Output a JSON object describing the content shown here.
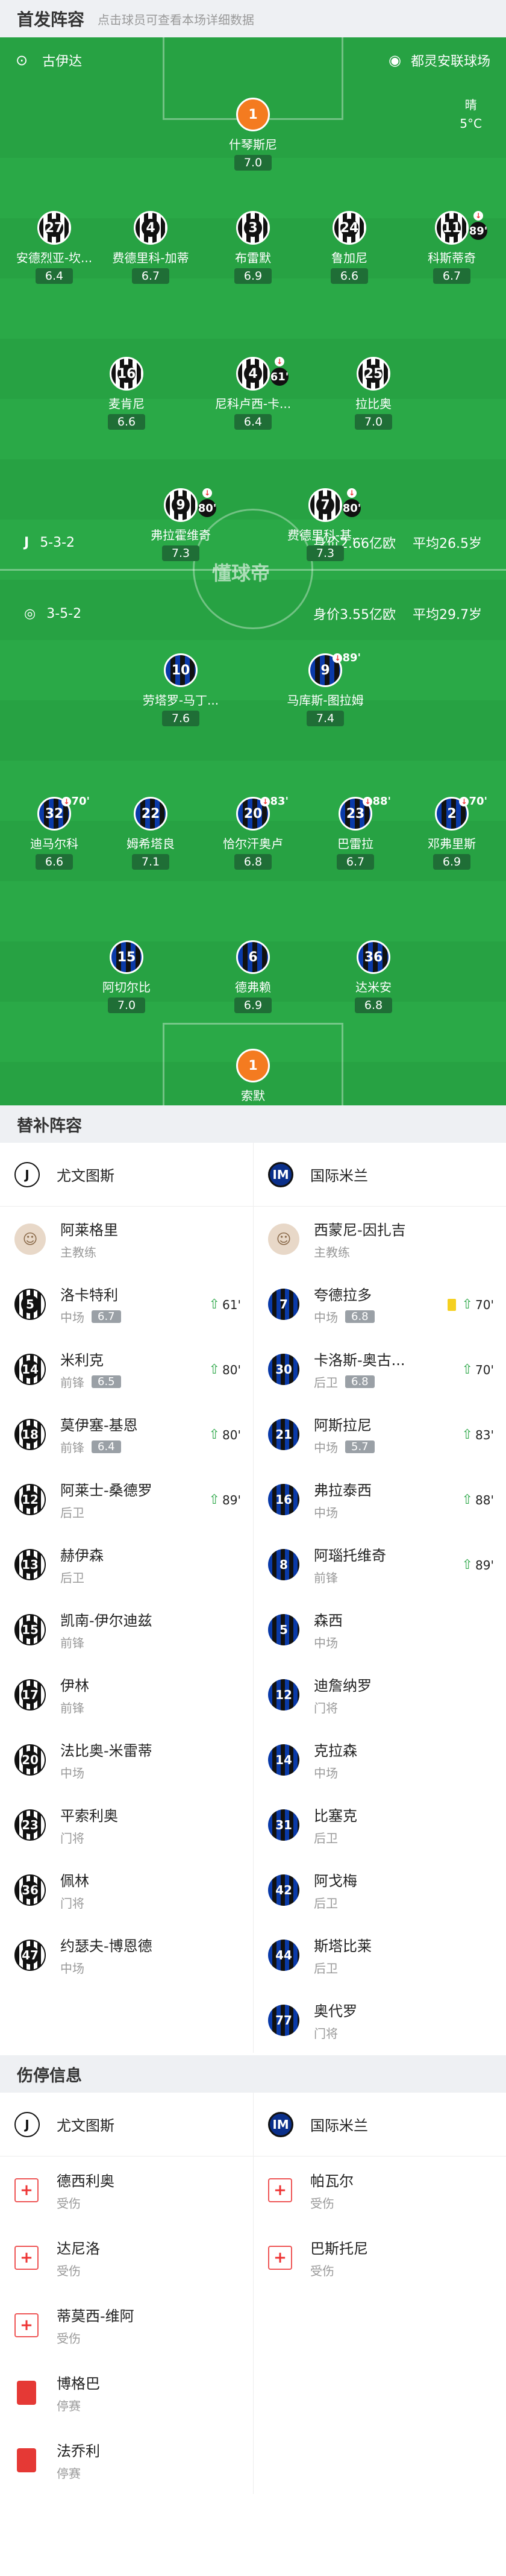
{
  "lineup_header": {
    "title": "首发阵容",
    "hint": "点击球员可查看本场详细数据"
  },
  "pitch": {
    "home_team": "古伊达",
    "stadium": "都灵安联球场",
    "weather": "晴",
    "temp": "5°C",
    "watermark": "懂球帝"
  },
  "juve": {
    "formation": "5-3-2",
    "value": "身价2.66亿欧",
    "age": "平均26.5岁"
  },
  "inter": {
    "formation": "3-5-2",
    "value": "身价3.55亿欧",
    "age": "平均29.7岁"
  },
  "players": [
    {
      "num": "1",
      "name": "什琴斯尼",
      "rating": "7.0",
      "team": "gk"
    },
    {
      "num": "27",
      "name": "安德烈亚-坎...",
      "rating": "6.4",
      "team": "juve"
    },
    {
      "num": "4",
      "name": "费德里科-加蒂",
      "rating": "6.7",
      "team": "juve"
    },
    {
      "num": "3",
      "name": "布雷默",
      "rating": "6.9",
      "team": "juve"
    },
    {
      "num": "24",
      "name": "鲁加尼",
      "rating": "6.6",
      "team": "juve"
    },
    {
      "num": "11",
      "name": "科斯蒂奇",
      "rating": "6.7",
      "team": "juve",
      "sub": "89'"
    },
    {
      "num": "16",
      "name": "麦肯尼",
      "rating": "6.6",
      "team": "juve"
    },
    {
      "num": "4",
      "name": "尼科卢西-卡...",
      "rating": "6.4",
      "team": "juve",
      "sub": "61'"
    },
    {
      "num": "25",
      "name": "拉比奥",
      "rating": "7.0",
      "team": "juve"
    },
    {
      "num": "9",
      "name": "弗拉霍维奇",
      "rating": "7.3",
      "team": "juve",
      "sub": "80'"
    },
    {
      "num": "7",
      "name": "费德里科-基...",
      "rating": "7.3",
      "team": "juve",
      "sub": "80'"
    },
    {
      "num": "10",
      "name": "劳塔罗-马丁...",
      "rating": "7.6",
      "team": "inter"
    },
    {
      "num": "9",
      "name": "马库斯-图拉姆",
      "rating": "7.4",
      "team": "inter",
      "sub": "89'"
    },
    {
      "num": "32",
      "name": "迪马尔科",
      "rating": "6.6",
      "team": "inter",
      "sub": "70'"
    },
    {
      "num": "22",
      "name": "姆希塔良",
      "rating": "7.1",
      "team": "inter"
    },
    {
      "num": "20",
      "name": "恰尔汗奥卢",
      "rating": "6.8",
      "team": "inter",
      "sub": "83'"
    },
    {
      "num": "23",
      "name": "巴雷拉",
      "rating": "6.7",
      "team": "inter",
      "sub": "88'"
    },
    {
      "num": "2",
      "name": "邓弗里斯",
      "rating": "6.9",
      "team": "inter",
      "sub": "70'"
    },
    {
      "num": "15",
      "name": "阿切尔比",
      "rating": "7.0",
      "team": "inter"
    },
    {
      "num": "6",
      "name": "德弗赖",
      "rating": "6.9",
      "team": "inter"
    },
    {
      "num": "36",
      "name": "达米安",
      "rating": "6.8",
      "team": "inter"
    },
    {
      "num": "1",
      "name": "索默",
      "rating": "6.7",
      "team": "gk"
    }
  ],
  "subs_header": {
    "title": "替补阵容"
  },
  "teams": {
    "juve": "尤文图斯",
    "inter": "国际米兰"
  },
  "coaches": {
    "juve_name": "阿莱格里",
    "juve_role": "主教练",
    "inter_name": "西蒙尼-因扎吉",
    "inter_role": "主教练"
  },
  "juve_subs": [
    {
      "num": "5",
      "name": "洛卡特利",
      "pos": "中场",
      "rating": "6.7",
      "in": "61'"
    },
    {
      "num": "14",
      "name": "米利克",
      "pos": "前锋",
      "rating": "6.5",
      "in": "80'"
    },
    {
      "num": "18",
      "name": "莫伊塞-基恩",
      "pos": "前锋",
      "rating": "6.4",
      "in": "80'"
    },
    {
      "num": "12",
      "name": "阿莱士-桑德罗",
      "pos": "后卫",
      "in": "89'"
    },
    {
      "num": "13",
      "name": "赫伊森",
      "pos": "后卫"
    },
    {
      "num": "15",
      "name": "凯南-伊尔迪兹",
      "pos": "前锋"
    },
    {
      "num": "17",
      "name": "伊林",
      "pos": "前锋"
    },
    {
      "num": "20",
      "name": "法比奥-米雷蒂",
      "pos": "中场"
    },
    {
      "num": "23",
      "name": "平索利奥",
      "pos": "门将"
    },
    {
      "num": "36",
      "name": "佩林",
      "pos": "门将"
    },
    {
      "num": "47",
      "name": "约瑟夫-博恩德",
      "pos": "中场"
    }
  ],
  "inter_subs": [
    {
      "num": "7",
      "name": "夸德拉多",
      "pos": "中场",
      "rating": "6.8",
      "in": "70'",
      "card": true
    },
    {
      "num": "30",
      "name": "卡洛斯-奥古...",
      "pos": "后卫",
      "rating": "6.8",
      "in": "70'"
    },
    {
      "num": "21",
      "name": "阿斯拉尼",
      "pos": "中场",
      "rating": "5.7",
      "in": "83'"
    },
    {
      "num": "16",
      "name": "弗拉泰西",
      "pos": "中场",
      "in": "88'"
    },
    {
      "num": "8",
      "name": "阿瑙托维奇",
      "pos": "前锋",
      "in": "89'"
    },
    {
      "num": "5",
      "name": "森西",
      "pos": "中场"
    },
    {
      "num": "12",
      "name": "迪詹纳罗",
      "pos": "门将"
    },
    {
      "num": "14",
      "name": "克拉森",
      "pos": "中场"
    },
    {
      "num": "31",
      "name": "比塞克",
      "pos": "后卫"
    },
    {
      "num": "42",
      "name": "阿戈梅",
      "pos": "后卫"
    },
    {
      "num": "44",
      "name": "斯塔比莱",
      "pos": "后卫"
    },
    {
      "num": "77",
      "name": "奥代罗",
      "pos": "门将"
    }
  ],
  "injury_header": {
    "title": "伤停信息"
  },
  "juve_inj": [
    {
      "name": "德西利奥",
      "status": "受伤",
      "type": "injury"
    },
    {
      "name": "达尼洛",
      "status": "受伤",
      "type": "injury"
    },
    {
      "name": "蒂莫西-维阿",
      "status": "受伤",
      "type": "injury"
    },
    {
      "name": "博格巴",
      "status": "停赛",
      "type": "suspension"
    },
    {
      "name": "法乔利",
      "status": "停赛",
      "type": "suspension"
    }
  ],
  "inter_inj": [
    {
      "name": "帕瓦尔",
      "status": "受伤",
      "type": "injury"
    },
    {
      "name": "巴斯托尼",
      "status": "受伤",
      "type": "injury"
    }
  ]
}
